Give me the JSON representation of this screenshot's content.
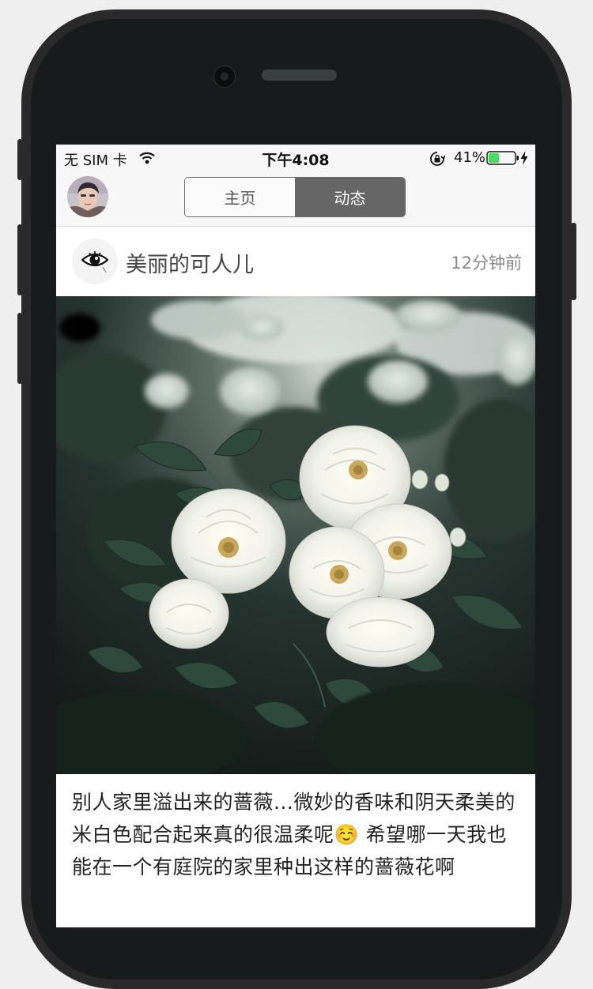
{
  "status_bar": {
    "carrier": "无 SIM 卡",
    "time": "下午4:08",
    "battery_percent": "41%",
    "battery_level": 0.41
  },
  "nav": {
    "tabs": [
      {
        "label": "主页",
        "selected": false
      },
      {
        "label": "动态",
        "selected": true
      }
    ]
  },
  "post": {
    "author": "美丽的可人儿",
    "time_ago": "12分钟前",
    "text": "别人家里溢出来的蔷薇...微妙的香味和阴天柔美的米白色配合起来真的很温柔呢☺️ 希望哪一天我也能在一个有庭院的家里种出这样的蔷薇花啊"
  },
  "icons": {
    "avatar": "user-avatar-photo",
    "author_badge": "eye-icon",
    "wifi": "wifi-icon",
    "lock": "rotation-lock-icon",
    "battery": "battery-icon",
    "charging": "bolt-icon"
  },
  "colors": {
    "segment_selected": "#666666",
    "battery_fill": "#4cd964"
  }
}
